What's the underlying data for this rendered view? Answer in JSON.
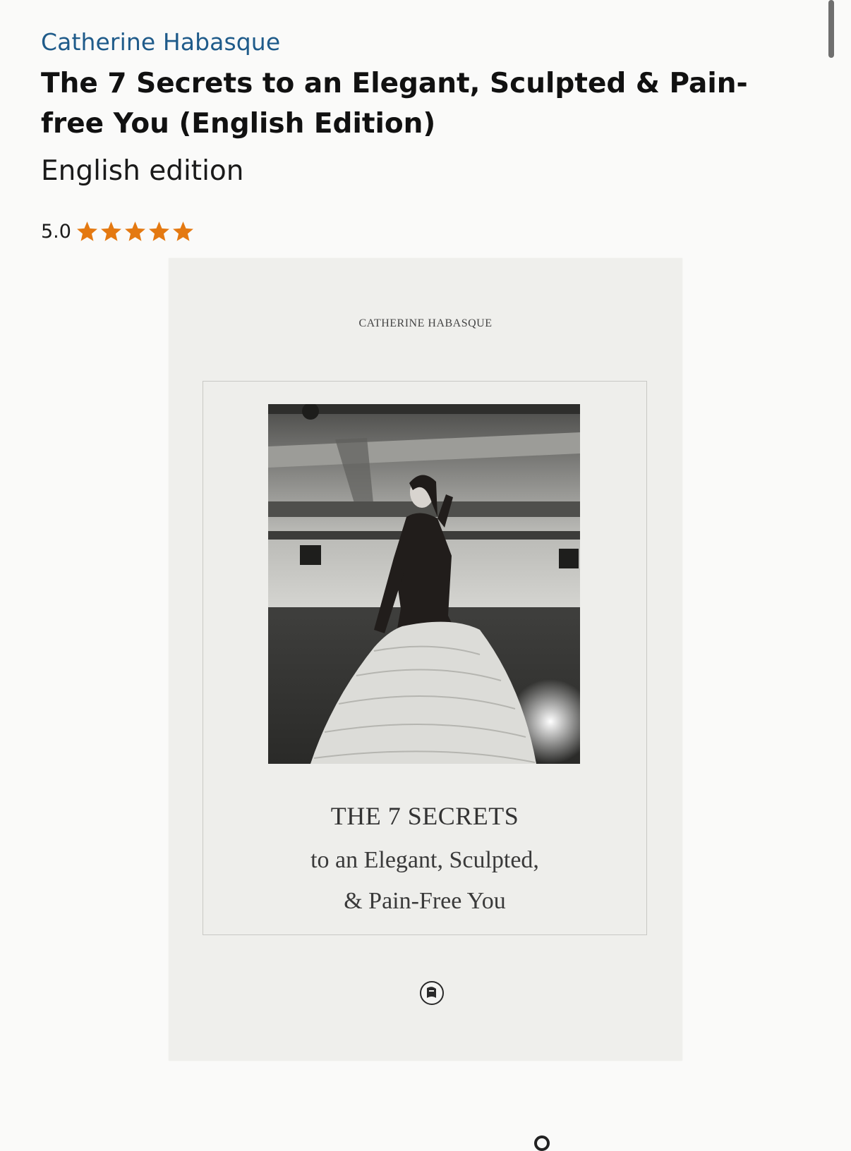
{
  "product": {
    "author": "Catherine Habasque",
    "title": "The 7 Secrets to an Elegant, Sculpted & Pain-free You (English Edition)",
    "edition": "English edition",
    "rating": {
      "value": "5.0",
      "stars": 5,
      "star_color": "#e47911"
    }
  },
  "cover": {
    "author": "CATHERINE HABASQUE",
    "title_line1": "THE 7 SECRETS",
    "title_line2": "to an Elegant, Sculpted,",
    "title_line3": "& Pain-Free You",
    "publisher_icon": "publisher-logo-icon"
  },
  "colors": {
    "link": "#1f5b8a",
    "background": "#fafaf9",
    "cover_background": "#efefec"
  }
}
